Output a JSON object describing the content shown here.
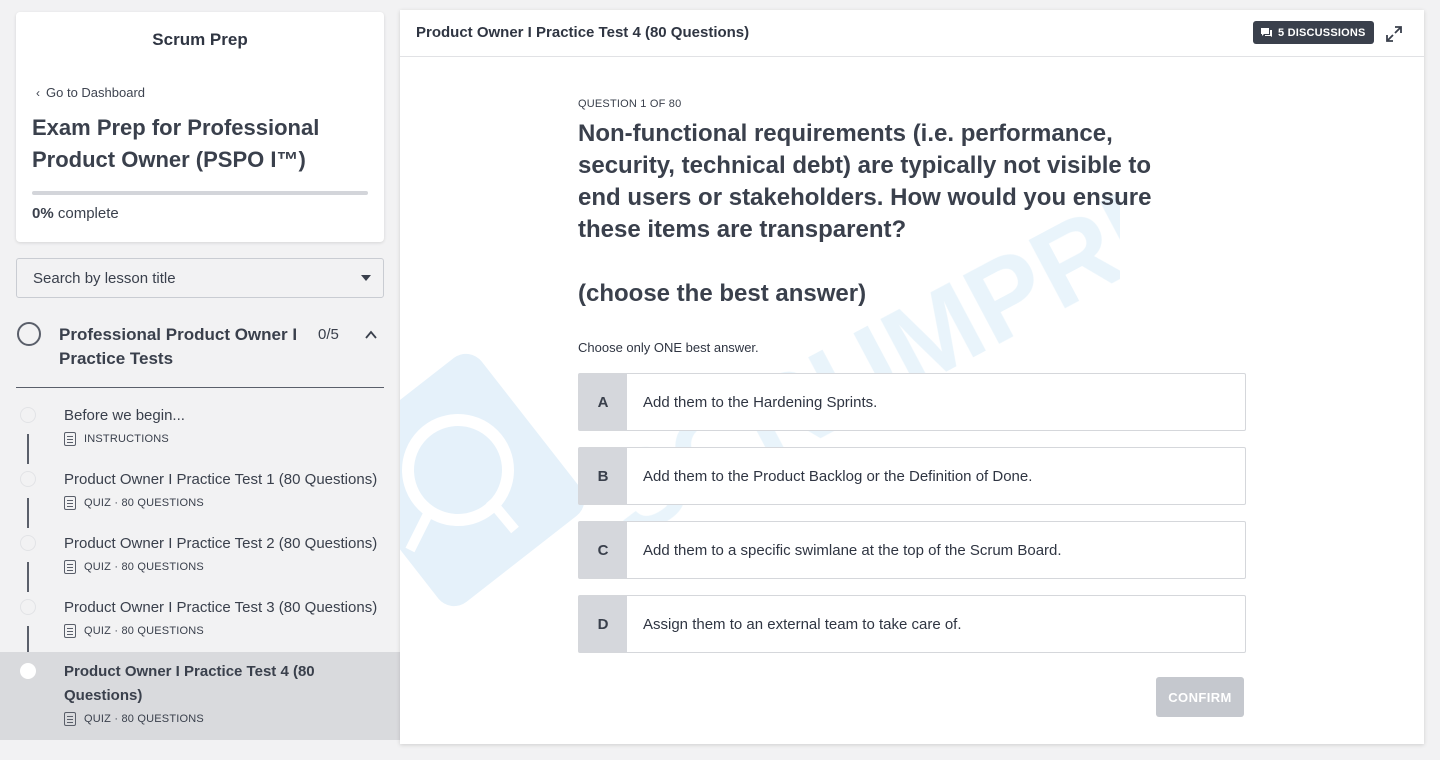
{
  "sidebar": {
    "site_name": "Scrum Prep",
    "back_link": "Go to Dashboard",
    "course_title": "Exam Prep for Professional Product Owner (PSPO I™)",
    "progress_percent": "0%",
    "progress_suffix": "complete",
    "progress_value": 0,
    "search_placeholder": "Search by lesson title",
    "chapter": {
      "title": "Professional Product Owner I Practice Tests",
      "count": "0/5"
    },
    "lessons": [
      {
        "title": "Before we begin...",
        "meta": "INSTRUCTIONS"
      },
      {
        "title": "Product Owner I Practice Test 1 (80 Questions)",
        "meta": "QUIZ · 80 QUESTIONS"
      },
      {
        "title": "Product Owner I Practice Test 2 (80 Questions)",
        "meta": "QUIZ · 80 QUESTIONS"
      },
      {
        "title": "Product Owner I Practice Test 3 (80 Questions)",
        "meta": "QUIZ · 80 QUESTIONS"
      },
      {
        "title": "Product Owner I Practice Test 4 (80 Questions)",
        "meta": "QUIZ · 80 QUESTIONS"
      }
    ]
  },
  "main": {
    "header_title": "Product Owner I Practice Test 4 (80 Questions)",
    "discussions_label": "5 DISCUSSIONS",
    "watermark_text": "SCRUMPREP",
    "question_label": "QUESTION 1 OF 80",
    "question_text": "Non-functional requirements (i.e. performance, security, technical debt) are typically not visible to end users or stakeholders. How would you ensure these items are transparent?",
    "question_sub": "(choose the best answer)",
    "instruction": "Choose only ONE best answer.",
    "answers": [
      {
        "letter": "A",
        "text": "Add them to the Hardening Sprints."
      },
      {
        "letter": "B",
        "text": "Add them to the Product Backlog or the Definition of Done."
      },
      {
        "letter": "C",
        "text": "Add them to a specific swimlane at the top of the Scrum Board."
      },
      {
        "letter": "D",
        "text": "Assign them to an external team to take care of."
      }
    ],
    "confirm_label": "CONFIRM"
  },
  "colors": {
    "accent_dark": "#3a404c",
    "page_bg": "#f2f2f3",
    "answer_letter_bg": "#d5d7dc",
    "confirm_disabled": "#c5c8ce",
    "watermark": "#d8ecf8"
  }
}
